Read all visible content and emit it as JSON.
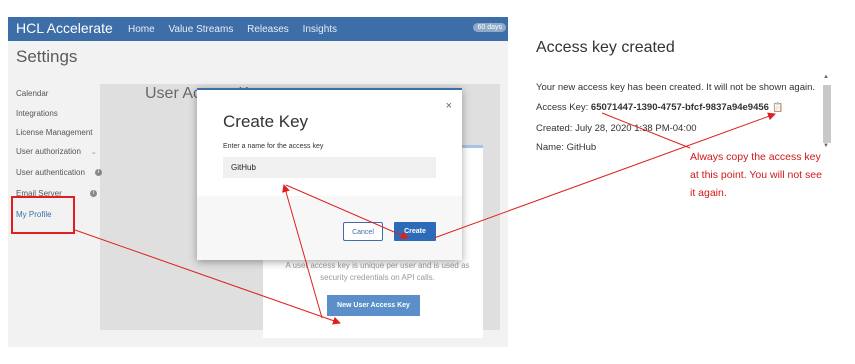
{
  "app": {
    "brand": "HCL Accelerate",
    "nav": [
      "Home",
      "Value Streams",
      "Releases",
      "Insights"
    ],
    "badge": "60 days"
  },
  "settings": {
    "title": "Settings",
    "sidebar": [
      {
        "label": "Calendar"
      },
      {
        "label": "Integrations"
      },
      {
        "label": "License Management"
      },
      {
        "label": "User authorization"
      },
      {
        "label": "User authentication"
      },
      {
        "label": "Email Server"
      },
      {
        "label": "My Profile"
      }
    ],
    "section_title": "User Access Keys"
  },
  "panel": {
    "text": "A user access key is unique per user and is used as security credentials on API calls.",
    "button": "New User Access Key"
  },
  "modal": {
    "title": "Create Key",
    "close": "×",
    "field_label": "Enter a name for the access key",
    "field_value": "GitHub",
    "cancel": "Cancel",
    "create": "Create"
  },
  "access_key": {
    "title": "Access key created",
    "message": "Your new access key has been created. It will not be shown again.",
    "key_label": "Access Key:",
    "key_value": "65071447-1390-4757-bfcf-9837a94e9456",
    "created": "Created: July 28, 2020 1:38 PM-04:00",
    "name": "Name: GitHub"
  },
  "note": "Always copy the access key at this point. You will not see it again.",
  "colors": {
    "topbar": "#3e6ea8",
    "annotation": "#e02020",
    "primary_button": "#2d6bb8"
  }
}
